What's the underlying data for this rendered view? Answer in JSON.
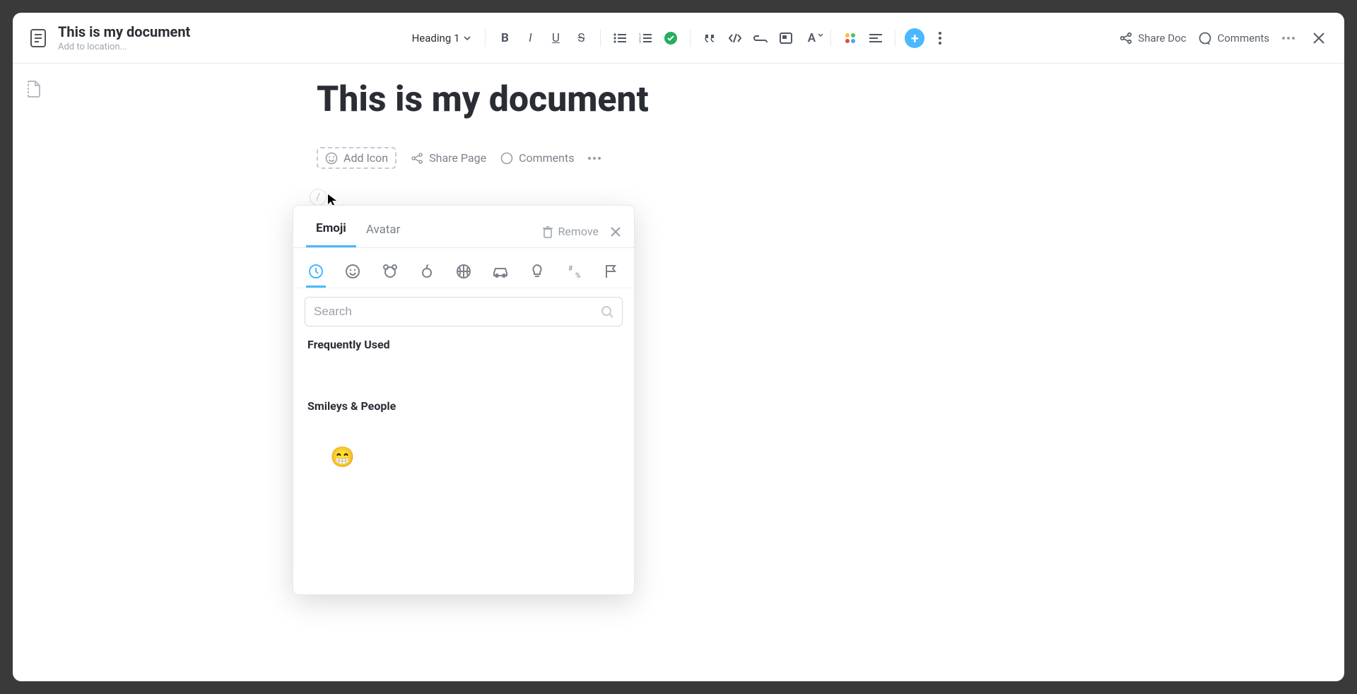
{
  "header": {
    "title": "This is my document",
    "location_placeholder": "Add to location...",
    "heading_dropdown": "Heading 1",
    "share_doc": "Share Doc",
    "comments": "Comments"
  },
  "page": {
    "title": "This is my document",
    "add_icon": "Add Icon",
    "share_page": "Share Page",
    "comments": "Comments",
    "slash_hint": "/"
  },
  "emoji_picker": {
    "tabs": {
      "emoji": "Emoji",
      "avatar": "Avatar"
    },
    "remove": "Remove",
    "search_placeholder": "Search",
    "sections": {
      "frequent": "Frequently Used",
      "smileys": "Smileys & People"
    },
    "categories": [
      "recent",
      "smileys",
      "animals",
      "food",
      "activity",
      "travel",
      "objects",
      "symbols",
      "flags"
    ],
    "visible_emoji": "😁"
  }
}
